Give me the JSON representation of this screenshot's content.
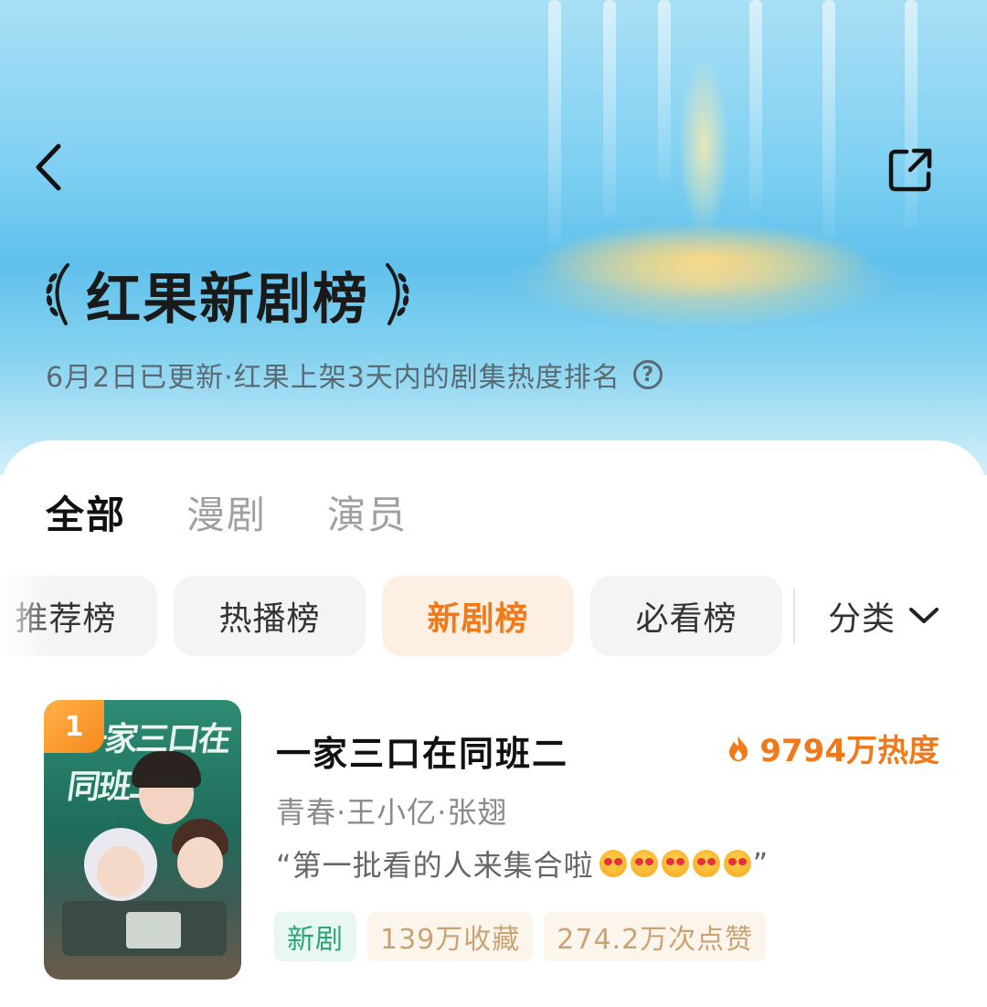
{
  "header": {
    "title": "红果新剧榜",
    "subtitle": "6月2日已更新·红果上架3天内的剧集热度排名",
    "help_symbol": "?"
  },
  "tabs": [
    {
      "label": "全部",
      "active": true
    },
    {
      "label": "漫剧",
      "active": false
    },
    {
      "label": "演员",
      "active": false
    }
  ],
  "chips": [
    {
      "label": "推荐榜",
      "active": false
    },
    {
      "label": "热播榜",
      "active": false
    },
    {
      "label": "新剧榜",
      "active": true
    },
    {
      "label": "必看榜",
      "active": false
    }
  ],
  "category_label": "分类",
  "items": [
    {
      "rank": "1",
      "poster_text": "一家三口在同班二",
      "title": "一家三口在同班二",
      "heat": "9794万热度",
      "tags": "青春·王小亿·张翅",
      "quote_open": "“第一批看的人来集合啦",
      "quote_close": "”",
      "emoji_count": 5,
      "emoji_name": "heart-eyes-emoji",
      "badges": {
        "new": "新剧",
        "favorites": "139万收藏",
        "likes": "274.2万次点赞"
      }
    }
  ],
  "colors": {
    "accent": "#f07a1a",
    "accent_bg": "#fdf0e2",
    "new_badge": "#2aa57c",
    "stat_badge": "#c9a374"
  },
  "icons": {
    "back": "chevron-left-icon",
    "share": "share-icon",
    "help": "help-circle-icon",
    "dropdown": "chevron-down-icon",
    "flame": "flame-icon",
    "laurel": "laurel-icon"
  }
}
